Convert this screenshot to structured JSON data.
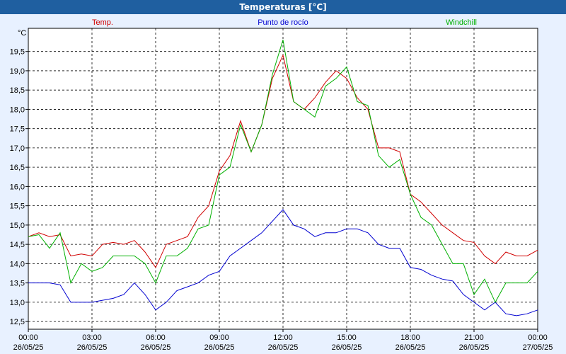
{
  "window": {
    "title": "Temperaturas [°C]"
  },
  "chart_data": {
    "type": "line",
    "title": "Temperaturas [°C]",
    "ylabel": "°C",
    "ylim": [
      12.3,
      20.1
    ],
    "y_ticks": [
      "12,5",
      "13,0",
      "13,5",
      "14,0",
      "14,5",
      "15,0",
      "15,5",
      "16,0",
      "16,5",
      "17,0",
      "17,5",
      "18,0",
      "18,5",
      "19,0",
      "19,5"
    ],
    "x_ticks": [
      {
        "time": "00:00",
        "date": "26/05/25"
      },
      {
        "time": "03:00",
        "date": "26/05/25"
      },
      {
        "time": "06:00",
        "date": "26/05/25"
      },
      {
        "time": "09:00",
        "date": "26/05/25"
      },
      {
        "time": "12:00",
        "date": "26/05/25"
      },
      {
        "time": "15:00",
        "date": "26/05/25"
      },
      {
        "time": "18:00",
        "date": "26/05/25"
      },
      {
        "time": "21:00",
        "date": "26/05/25"
      },
      {
        "time": "00:00",
        "date": "27/05/25"
      }
    ],
    "x_hours": [
      0,
      0.5,
      1,
      1.5,
      2,
      2.5,
      3,
      3.5,
      4,
      4.5,
      5,
      5.5,
      6,
      6.5,
      7,
      7.5,
      8,
      8.5,
      9,
      9.5,
      10,
      10.5,
      11,
      11.5,
      12,
      12.5,
      13,
      13.5,
      14,
      14.5,
      15,
      15.5,
      16,
      16.5,
      17,
      17.5,
      18,
      18.5,
      19,
      19.5,
      20,
      20.5,
      21,
      21.5,
      22,
      22.5,
      23,
      23.5,
      24
    ],
    "grid": true,
    "legend_position": "top",
    "series": [
      {
        "name": "Temp.",
        "color": "#d00000",
        "values": [
          14.7,
          14.8,
          14.7,
          14.75,
          14.2,
          14.25,
          14.2,
          14.5,
          14.55,
          14.5,
          14.6,
          14.3,
          13.9,
          14.5,
          14.6,
          14.7,
          15.2,
          15.5,
          16.4,
          16.8,
          17.7,
          16.9,
          17.6,
          18.8,
          19.4,
          18.2,
          18.0,
          18.3,
          18.7,
          19.0,
          18.8,
          18.3,
          18.0,
          17.0,
          17.0,
          16.9,
          15.8,
          15.6,
          15.3,
          15.0,
          14.8,
          14.6,
          14.55,
          14.2,
          14.0,
          14.3,
          14.2,
          14.2,
          14.35
        ]
      },
      {
        "name": "Punto de rocío",
        "color": "#0000d0",
        "values": [
          13.5,
          13.5,
          13.5,
          13.45,
          13.0,
          13.0,
          13.0,
          13.05,
          13.1,
          13.2,
          13.5,
          13.2,
          12.8,
          13.0,
          13.3,
          13.4,
          13.5,
          13.7,
          13.8,
          14.2,
          14.4,
          14.6,
          14.8,
          15.1,
          15.4,
          15.0,
          14.9,
          14.7,
          14.8,
          14.8,
          14.9,
          14.9,
          14.8,
          14.5,
          14.4,
          14.4,
          13.9,
          13.85,
          13.7,
          13.6,
          13.55,
          13.2,
          13.0,
          12.8,
          13.0,
          12.7,
          12.65,
          12.7,
          12.8
        ]
      },
      {
        "name": "Windchill",
        "color": "#00b000",
        "values": [
          14.7,
          14.75,
          14.4,
          14.8,
          13.5,
          14.0,
          13.8,
          13.9,
          14.2,
          14.2,
          14.2,
          14.0,
          13.5,
          14.2,
          14.2,
          14.4,
          14.9,
          15.0,
          16.3,
          16.5,
          17.6,
          16.9,
          17.6,
          18.9,
          19.8,
          18.2,
          18.0,
          17.8,
          18.6,
          18.8,
          19.1,
          18.2,
          18.1,
          16.8,
          16.5,
          16.7,
          15.8,
          15.2,
          15.0,
          14.5,
          14.0,
          14.0,
          13.2,
          13.6,
          13.0,
          13.5,
          13.5,
          13.5,
          13.8
        ]
      }
    ]
  }
}
